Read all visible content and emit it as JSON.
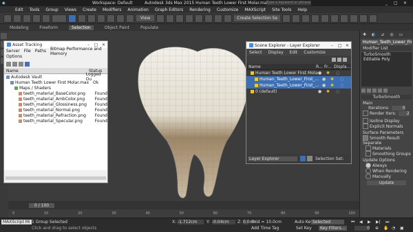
{
  "titlebar": {
    "workspace": "Workspace: Default",
    "title": "Autodesk 3ds Max 2015    Human Teeth Lower First Molar.max",
    "search_placeholder": "Type a keyword or phrase"
  },
  "menu": [
    "Edit",
    "Tools",
    "Group",
    "Views",
    "Create",
    "Modifiers",
    "Animation",
    "Graph Editors",
    "Rendering",
    "Customize",
    "MAXScript",
    "Site Tools",
    "Help"
  ],
  "toolbar": {
    "view_label": "View",
    "create_selection_set": "Create Selection Se"
  },
  "ribbon": [
    "Modeling",
    "Freeform",
    "Selection",
    "Object Paint",
    "Populate"
  ],
  "asset_tracking": {
    "title": "Asset Tracking",
    "menu": [
      "Server",
      "File",
      "Paths",
      "Bitmap Performance and Memory",
      "Options"
    ],
    "columns": [
      "Name",
      "Status"
    ],
    "rows": [
      {
        "name": "Autodesk Vault",
        "status": "Logged Ou"
      },
      {
        "name": "Human Teeth Lower First Molar.max",
        "status": "Ok"
      },
      {
        "name": "Maps / Shaders",
        "status": ""
      },
      {
        "name": "teeth_material_BaseColor.png",
        "status": "Found"
      },
      {
        "name": "teeth_material_AmbColor.png",
        "status": "Found"
      },
      {
        "name": "teeth_material_Glossiness.png",
        "status": "Found"
      },
      {
        "name": "teeth_material_Normal.png",
        "status": "Found"
      },
      {
        "name": "teeth_material_Refraction.png",
        "status": "Found"
      },
      {
        "name": "teeth_material_Specular.png",
        "status": "Found"
      }
    ]
  },
  "scene_explorer": {
    "title": "Scene Explorer - Layer Explorer",
    "menu": [
      "Select",
      "Display",
      "Edit",
      "Customize"
    ],
    "columns": [
      "Name",
      "R...",
      "Fr...",
      "Displa..."
    ],
    "rows": [
      {
        "name": "Human Teeth Lower First Molar",
        "selected": false,
        "indent": 1
      },
      {
        "name": "Human_Teeth_Lower_First_...",
        "selected": true,
        "indent": 2
      },
      {
        "name": "Human_Teeth_Lower_First_...",
        "selected": true,
        "indent": 2
      },
      {
        "name": "0 (default)",
        "selected": false,
        "indent": 1
      }
    ],
    "footer_dropdown": "Layer Explorer",
    "selection_set_label": "Selection Set:"
  },
  "command_panel": {
    "object_name": "Human_Teeth_Lower_Fir",
    "modifier_list": "Modifier List",
    "stack": [
      "TurboSmooth",
      "Editable Poly"
    ],
    "rollout_title": "TurboSmooth",
    "main_label": "Main",
    "iterations_label": "Iterations:",
    "iterations_value": "0",
    "render_iters_label": "Render Iters:",
    "render_iters_value": "2",
    "isoline_display": "Isoline Display",
    "explicit_normals": "Explicit Normals",
    "surface_params_label": "Surface Parameters",
    "smooth_result": "Smooth Result",
    "separate_label": "Separate",
    "materials": "Materials",
    "smoothing_groups": "Smoothing Groups",
    "update_options_label": "Update Options",
    "always": "Always",
    "when_rendering": "When Rendering",
    "manually": "Manually",
    "update_button": "Update"
  },
  "timeline": {
    "frame": "0 / 100",
    "ticks": [
      "0",
      "10",
      "20",
      "30",
      "40",
      "50",
      "60",
      "70",
      "80",
      "90",
      "100"
    ]
  },
  "status": {
    "maxscript_hint": "MAXScript Mi",
    "group_selected": "1 Group Selected",
    "prompt": "Click and drag to select objects",
    "x_label": "X:",
    "x_value": "-1.712cm",
    "y_label": "Y:",
    "y_value": "-0.04cm",
    "z_label": "Z:",
    "z_value": "0.0cm",
    "grid": "Grid = 10.0cm",
    "add_time_tag": "Add Time Tag",
    "auto_key": "Auto Key",
    "selected_dropdown": "Selected",
    "set_key": "Set Key",
    "key_filters": "Key Filters...",
    "frame_value": "0"
  },
  "colors": {
    "accent": "#3d6fb5",
    "viewport_bg": "#3c3c3c",
    "found": "#222222"
  }
}
